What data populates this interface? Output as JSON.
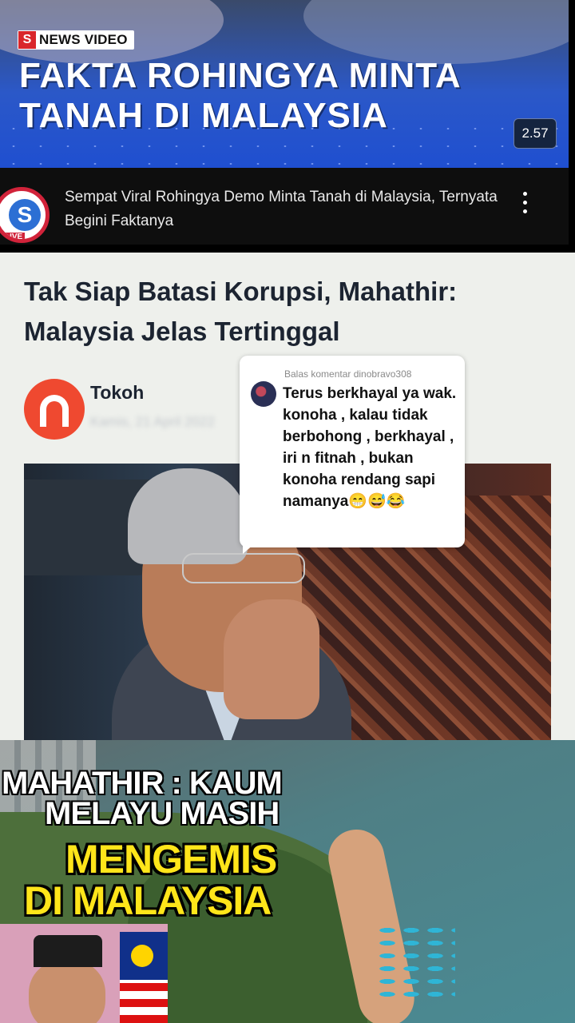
{
  "video": {
    "badge": "NEWS VIDEO",
    "badge_logo": "S",
    "title": "FAKTA ROHINGYA MINTA TANAH DI MALAYSIA",
    "duration": "2.57",
    "description": "Sempat Viral Rohingya Demo Minta Tanah di Malaysia, Ternyata Begini Faktanya",
    "channel_logo": "S",
    "channel_tag": "LIVE"
  },
  "article": {
    "title": "Tak Siap Batasi Korupsi, Mahathir: Malaysia Jelas Tertinggal",
    "publisher": "Tokoh",
    "date_blurred": "Kamis, 21 April 2022"
  },
  "comment": {
    "reply_to": "Balas komentar dinobravo308",
    "text": "Terus berkhayal ya wak. konoha , kalau tidak berbohong , berkhayal , iri n fitnah , bukan konoha rendang sapi namanya😁😅😂"
  },
  "thumbnail": {
    "line1": "MAHATHIR : KAUM",
    "line2": "MELAYU MASIH",
    "line3": "MENGEMIS",
    "line4": "DI MALAYSIA"
  },
  "colors": {
    "news_red": "#d9262b",
    "tokoh_orange": "#ef4930",
    "headline_yellow": "#ffe51a",
    "article_bg": "#eef0ec"
  },
  "icons": [
    "more-vertical-icon",
    "channel-avatar-icon",
    "publisher-logo-icon",
    "commenter-avatar-icon"
  ]
}
